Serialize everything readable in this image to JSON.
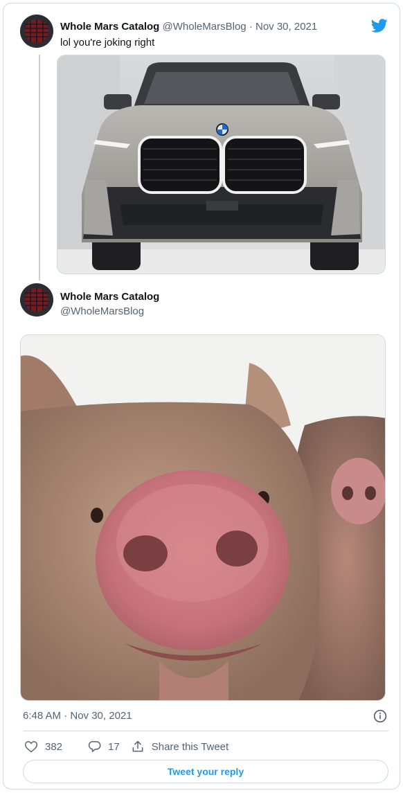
{
  "parent_tweet": {
    "author_name": "Whole Mars Catalog",
    "author_handle": "@WholeMarsBlog",
    "separator": "·",
    "date": "Nov 30, 2021",
    "text": "lol you're joking right",
    "image_subject": "car-front-photo"
  },
  "main_tweet": {
    "author_name": "Whole Mars Catalog",
    "author_handle": "@WholeMarsBlog",
    "image_subject": "pig-snout-photo",
    "timestamp": "6:48 AM · Nov 30, 2021"
  },
  "actions": {
    "likes": "382",
    "replies": "17",
    "share_label": "Share this Tweet"
  },
  "reply_button": {
    "label": "Tweet your reply"
  },
  "colors": {
    "accent": "#1d9bf0",
    "text_primary": "#0f1419",
    "text_secondary": "#536471",
    "border": "#cfd9de"
  },
  "icons": [
    "twitter-logo-icon",
    "info-icon",
    "heart-icon",
    "reply-bubble-icon",
    "share-icon"
  ]
}
